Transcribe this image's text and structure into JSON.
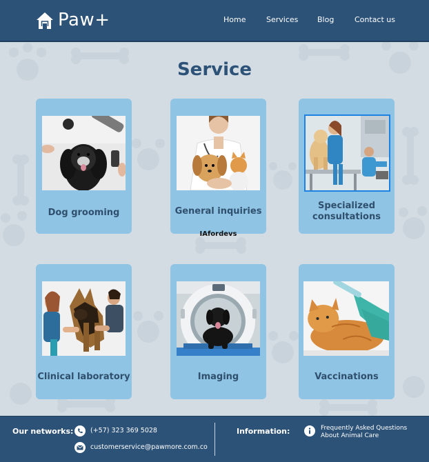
{
  "header": {
    "logo_text": "Paw+",
    "nav": [
      "Home",
      "Services",
      "Blog",
      "Contact us"
    ]
  },
  "main": {
    "title": "Service",
    "watermark": "IAfordevs",
    "cards": [
      {
        "label": "Dog grooming",
        "image": "black spaniel dog being groomed with dryer and scissors"
      },
      {
        "label": "General inquiries",
        "image": "veterinarian holding puppy and kitten"
      },
      {
        "label": "Specialized consultations",
        "image": "vets examining golden retriever on table"
      },
      {
        "label": "Clinical laboratory",
        "image": "vet taking blood sample from german shepherd"
      },
      {
        "label": "Imaging",
        "image": "black labrador lying in CT scanner"
      },
      {
        "label": "Vaccinations",
        "image": "orange tabby cat receiving injection"
      }
    ]
  },
  "footer": {
    "networks_label": "Our networks:",
    "phone": "(+57) 323 369 5028",
    "email": "customerservice@pawmore.com.co",
    "information_label": "Information:",
    "faq_link": "Frequently Asked Questions About Animal Care"
  },
  "colors": {
    "header_bg": "#2d5278",
    "card_bg": "#8fc4e4",
    "title": "#2d5278",
    "selected_outline": "#1b82e3"
  },
  "icons": [
    "home-icon",
    "whatsapp-icon",
    "mail-icon",
    "info-icon"
  ]
}
